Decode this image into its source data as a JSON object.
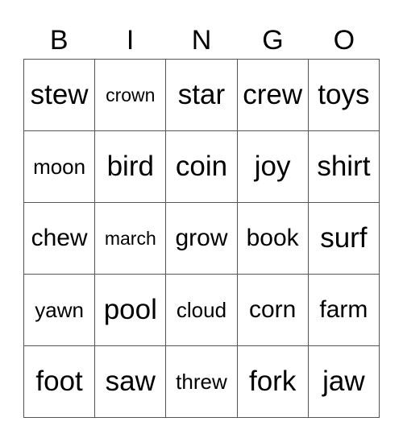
{
  "header": [
    "B",
    "I",
    "N",
    "G",
    "O"
  ],
  "rows": [
    [
      "stew",
      "crown",
      "star",
      "crew",
      "toys"
    ],
    [
      "moon",
      "bird",
      "coin",
      "joy",
      "shirt"
    ],
    [
      "chew",
      "march",
      "grow",
      "book",
      "surf"
    ],
    [
      "yawn",
      "pool",
      "cloud",
      "corn",
      "farm"
    ],
    [
      "foot",
      "saw",
      "threw",
      "fork",
      "jaw"
    ]
  ]
}
